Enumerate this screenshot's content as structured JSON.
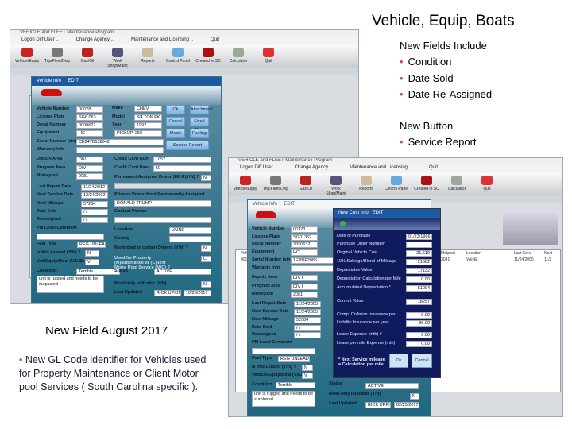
{
  "slide": {
    "title": "Vehicle, Equip, Boats",
    "new_fields_heading": "New Fields Include",
    "new_fields": [
      "Condition",
      "Date Sold",
      "Date Re-Assigned"
    ],
    "new_button_heading": "New Button",
    "new_buttons": [
      "Service Report"
    ],
    "august_heading": "New Field August 2017",
    "august_note": "New GL Code identifier for Vehicles used for Property Maintenance or Client Motor pool Services ( South Carolina specific )."
  },
  "app": {
    "window_title": "VEHICLE and FLEET Maintenance Program",
    "menu": [
      "Logon Diff User ..",
      "Change Agency ..",
      "Maintenance and Licensing ..",
      "Quit"
    ],
    "toolbar": [
      "Vehicle/Equip",
      "Trip/Fleet/Disp",
      "Gas/Oil",
      "Work Shop/Maint",
      "Reports",
      "Control Panel",
      "Created in SC",
      "Calculator",
      "Quit"
    ],
    "accent": "#1c5aa0"
  },
  "left_dialog": {
    "title": "Vehicle Info",
    "mode": "EDIT",
    "fields_left": [
      {
        "label": "Vehicle Number",
        "value": "00028"
      },
      {
        "label": "License Plate",
        "value": "SG6 063"
      },
      {
        "label": "Decal Number",
        "value": "0000622"
      },
      {
        "label": "Equipment",
        "value": "HC"
      },
      {
        "label": "Serial Number (vin)",
        "value": "CE247B138042"
      },
      {
        "label": "Warranty Info",
        "value": ""
      },
      {
        "label": "Deputy Area",
        "value": "DIV"
      },
      {
        "label": "Program Area",
        "value": "DIV"
      },
      {
        "label": "Motorpool",
        "value": "2081"
      },
      {
        "label": "Last Repair Date",
        "value": "11/24/2012"
      },
      {
        "label": "Next Service Date",
        "value": "12/24/2012"
      },
      {
        "label": "Next Mileage",
        "value": "57284"
      },
      {
        "label": "Date Sold",
        "value": "/ /"
      },
      {
        "label": "Reassigned",
        "value": "/ /"
      },
      {
        "label": "PM Level Comment",
        "value": ""
      },
      {
        "label": "Fuel Type",
        "value": "REG UNLEADED"
      },
      {
        "label": "Is this Leased (Y/N) ?",
        "value": "N"
      },
      {
        "label": "Veh/Equip/Boat (V/E/B)",
        "value": "V"
      },
      {
        "label": "Condition",
        "value": "Terrible"
      }
    ],
    "comment": "unit is rugged and needs to be surplused",
    "make": {
      "label": "Make",
      "value": "CHEV"
    },
    "model": {
      "label": "Model",
      "value": "3/4 TON PK"
    },
    "year": {
      "label": "Year",
      "value": "1992"
    },
    "equipment_desc": "PICKUP, 250",
    "buttons": [
      "Ok",
      "Attachment",
      "Cancel",
      "Fixed Cost",
      "Meals",
      "Fueling",
      "Service Report"
    ],
    "fields_right": [
      {
        "label": "Credit Card Gun",
        "value": "1057"
      },
      {
        "label": "Credit Card Pass",
        "value": "50"
      },
      {
        "label": "Permanent Assigned Driver SMHI (Y/N) ?",
        "value": "N"
      },
      {
        "label": "Primary Driver if not Permanently Assigned",
        "value": "DONALD TRUMP"
      },
      {
        "label": "Contact Person",
        "value": ""
      },
      {
        "label": "Location",
        "value": "VAINE"
      },
      {
        "label": "County",
        "value": ""
      },
      {
        "label": "Restricted to certain Drivers (Y/N) ?",
        "value": "N"
      },
      {
        "label": "Used for Property (M)aintenance or (C)lient Motor Pool Service (M/C) ?",
        "value": "C"
      },
      {
        "label": "Status",
        "value": "ACTIVE"
      },
      {
        "label": "Read only Indicator (Y/N)",
        "value": "N"
      }
    ],
    "last_updated": {
      "label": "Last Updated",
      "user": "RICK UPKIN",
      "date": "10/23/2017"
    }
  },
  "right_window": {
    "vehicle_dialog": {
      "title": "Vehicle Info",
      "mode": "EDIT",
      "fields": [
        {
          "label": "Vehicle Number",
          "value": "00123"
        },
        {
          "label": "License Plate",
          "value": "SG01362"
        },
        {
          "label": "Decal Number",
          "value": "3090632"
        },
        {
          "label": "Equipment",
          "value": "HC"
        },
        {
          "label": "Serial Number (vin)",
          "value": "1FDNF2086..."
        },
        {
          "label": "Warranty Info",
          "value": ""
        },
        {
          "label": "Deputy Area",
          "value": "DIV I"
        },
        {
          "label": "Program Area",
          "value": "DIV I"
        },
        {
          "label": "Motorpool",
          "value": "2081"
        },
        {
          "label": "Last Repair Date",
          "value": "11/24/2005"
        },
        {
          "label": "Next Service Date",
          "value": "11/24/2005"
        },
        {
          "label": "Next Mileage",
          "value": "52084"
        },
        {
          "label": "Date Sold",
          "value": "/ /"
        },
        {
          "label": "Reassigned",
          "value": "/ /"
        },
        {
          "label": "PM Level Comment",
          "value": ""
        },
        {
          "label": "Fuel Type",
          "value": "REG UNLEADED"
        },
        {
          "label": "Is this Leased (Y/N) ?",
          "value": "N"
        },
        {
          "label": "Vehicle/Equip/Boat (V/E/B)",
          "value": "V"
        },
        {
          "label": "Condition",
          "value": "Terrible"
        }
      ],
      "comment": "unit is rugged and needs to be surplused",
      "status": {
        "label": "Status",
        "value": "ACTIVE"
      },
      "read_only": {
        "label": "Read only Indicator (Y/N)",
        "value": "N"
      },
      "last_updated": {
        "label": "Last Updated",
        "user": "RICK URPIN",
        "date": "02/25/2017"
      }
    },
    "cost_dialog": {
      "title": "New Cost Info",
      "mode": "EDIT",
      "fields": [
        {
          "label": "Date of Purchase",
          "value": "01/23/1996"
        },
        {
          "label": "Purchase Order Number",
          "value": ""
        },
        {
          "label": "Original Vehicle Cost",
          "value": "21,619"
        },
        {
          "label": "10% Salvage/Blend of Mileage",
          "value": "21682"
        },
        {
          "label": "Depreciable Value",
          "value": "17132"
        },
        {
          "label": "Depreciation Calculation per Mile",
          "value": "0.00"
        },
        {
          "label": "Accumulated Depreciation *",
          "value": "51004"
        },
        {
          "label": "Current Value",
          "value": "18257"
        },
        {
          "label": "Comp. Collision Insurance per",
          "value": "0.00"
        },
        {
          "label": "Liability Insurance per year",
          "value": "36.00"
        },
        {
          "label": "Lease Expense (mth) if",
          "value": "0.00"
        },
        {
          "label": "Lease per mile Expense (mth)",
          "value": "0.00"
        }
      ],
      "note": "* Next Service mileage a Calculation per mile",
      "ok": "Ok",
      "cancel": "Cancel"
    },
    "grid": {
      "headers": [
        "Vehic",
        "Motpool",
        "Location",
        "Last Serv",
        "Next"
      ],
      "row": [
        "00123",
        "2081",
        "VAINE",
        "11/24/2005",
        "11/2"
      ]
    }
  }
}
